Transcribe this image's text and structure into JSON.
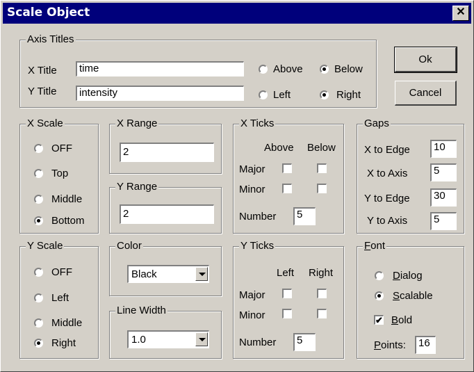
{
  "window": {
    "title": "Scale Object",
    "close_glyph": "✕"
  },
  "axis_titles": {
    "legend": "Axis Titles",
    "x_label": "X Title",
    "x_value": "time",
    "y_label": "Y Title",
    "y_value": "intensity",
    "above": "Above",
    "below": "Below",
    "left": "Left",
    "right": "Right",
    "x_position_selected": "Below",
    "y_position_selected": "Right"
  },
  "buttons": {
    "ok": "Ok",
    "cancel": "Cancel"
  },
  "x_scale": {
    "legend": "X Scale",
    "options": [
      "OFF",
      "Top",
      "Middle",
      "Bottom"
    ],
    "selected": "Bottom"
  },
  "y_scale": {
    "legend": "Y Scale",
    "options": [
      "OFF",
      "Left",
      "Middle",
      "Right"
    ],
    "selected": "Right"
  },
  "x_range": {
    "legend": "X Range",
    "value": "2"
  },
  "y_range": {
    "legend": "Y Range",
    "value": "2"
  },
  "color": {
    "legend": "Color",
    "value": "Black"
  },
  "line_width": {
    "legend": "Line Width",
    "value": "1.0"
  },
  "x_ticks": {
    "legend": "X Ticks",
    "col1": "Above",
    "col2": "Below",
    "major": "Major",
    "minor": "Minor",
    "number_label": "Number",
    "number_value": "5",
    "major_above": false,
    "major_below": false,
    "minor_above": false,
    "minor_below": false
  },
  "y_ticks": {
    "legend": "Y Ticks",
    "col1": "Left",
    "col2": "Right",
    "major": "Major",
    "minor": "Minor",
    "number_label": "Number",
    "number_value": "5",
    "major_left": false,
    "major_right": false,
    "minor_left": false,
    "minor_right": false
  },
  "gaps": {
    "legend": "Gaps",
    "x_to_edge_label": "X to Edge",
    "x_to_edge": "10",
    "x_to_axis_label": "X to Axis",
    "x_to_axis": "5",
    "y_to_edge_label": "Y to Edge",
    "y_to_edge": "30",
    "y_to_axis_label": "Y to Axis",
    "y_to_axis": "5"
  },
  "font": {
    "legend_first": "F",
    "legend_rest": "ont",
    "dialog_first": "D",
    "dialog_rest": "ialog",
    "scalable_first": "S",
    "scalable_rest": "calable",
    "bold_first": "B",
    "bold_rest": "old",
    "points_first": "P",
    "points_rest": "oints:",
    "points_value": "16",
    "selected": "Scalable",
    "bold_checked": true,
    "check_glyph": "✔"
  }
}
